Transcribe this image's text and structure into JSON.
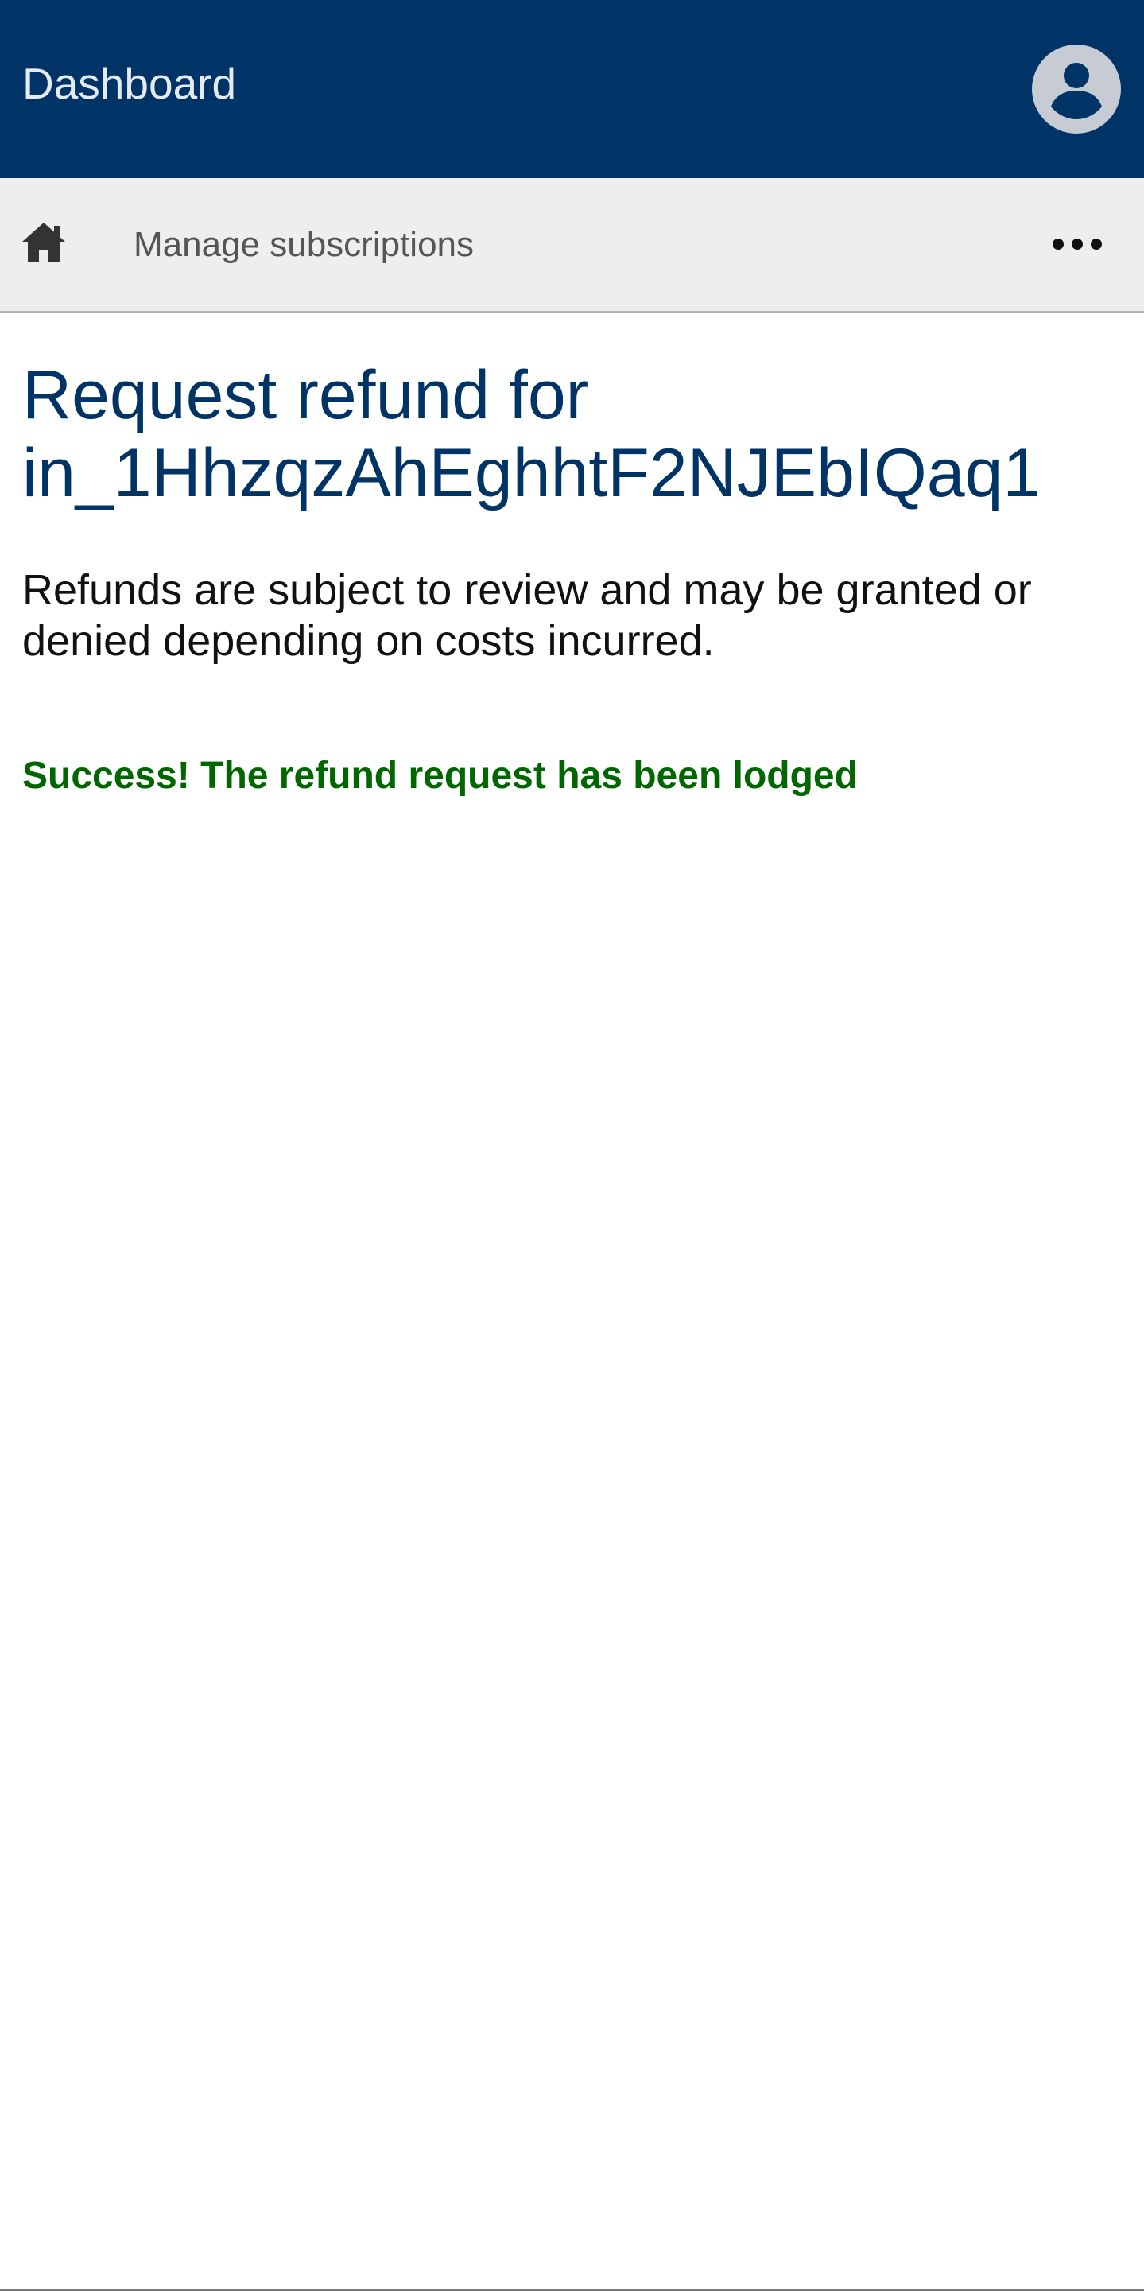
{
  "header": {
    "title": "Dashboard",
    "avatar_icon": "user-circle-icon",
    "background_color": "#003366"
  },
  "nav": {
    "home_icon": "home-icon",
    "items": [
      {
        "label": "Manage subscriptions"
      }
    ],
    "more_icon": "more-horizontal-icon"
  },
  "main": {
    "title_line1": "Request refund for",
    "title_line2": "in_1HhzqzAhEghhtF2NJEbIQaq1",
    "description": "Refunds are subject to review and may be granted or denied depending on costs incurred.",
    "success_message": "Success! The refund request has been lodged"
  },
  "colors": {
    "brand": "#003366",
    "success": "#006600",
    "nav_background": "#eeeeee"
  }
}
